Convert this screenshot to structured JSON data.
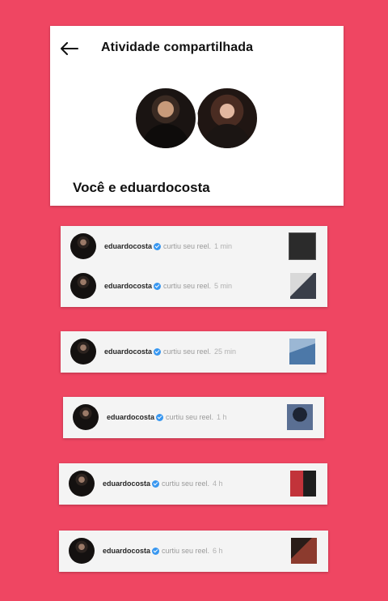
{
  "header": {
    "title": "Atividade compartilhada",
    "back_icon": "arrow-left-icon",
    "subtitle": "Você e eduardocosta"
  },
  "notifications": [
    {
      "user": "eduardocosta",
      "action": "curtiu seu reel.",
      "time": "1 min",
      "thumb_color": "#2b2b2b"
    },
    {
      "user": "eduardocosta",
      "action": "curtiu seu reel.",
      "time": "5 min",
      "thumb_color": "#3a3f4a"
    },
    {
      "user": "eduardocosta",
      "action": "curtiu seu reel.",
      "time": "25 min",
      "thumb_color": "#4c78a8"
    },
    {
      "user": "eduardocosta",
      "action": "curtiu seu reel.",
      "time": "1 h",
      "thumb_color": "#5a6f93"
    },
    {
      "user": "eduardocosta",
      "action": "curtiu seu reel.",
      "time": "4 h",
      "thumb_color": "#c2333a"
    },
    {
      "user": "eduardocosta",
      "action": "curtiu seu reel.",
      "time": "6 h",
      "thumb_color": "#8c3b2e"
    }
  ],
  "colors": {
    "background": "#ef4662",
    "verified": "#3897f0"
  }
}
